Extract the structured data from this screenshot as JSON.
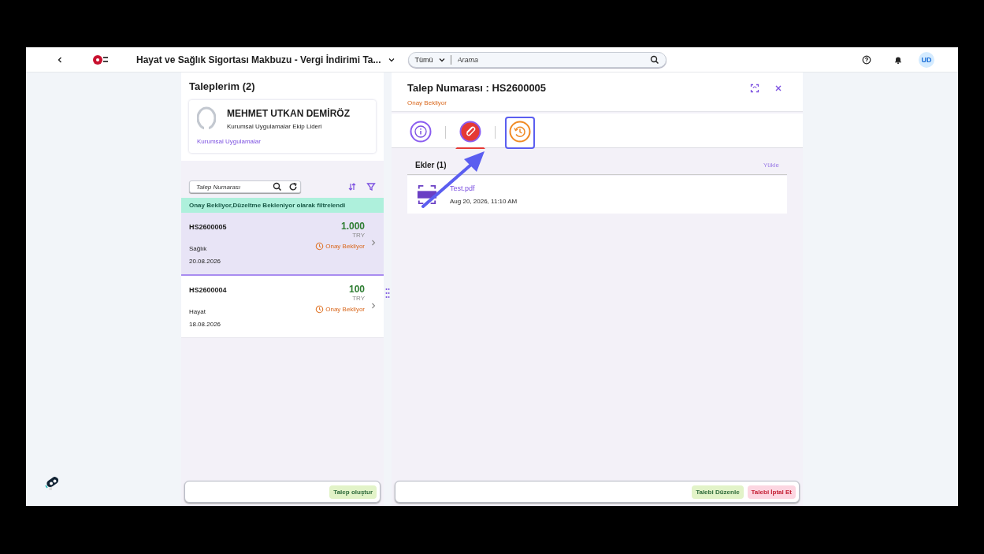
{
  "header": {
    "title": "Hayat ve Sağlık Sigortası Makbuzu - Vergi İndirimi Ta...",
    "search": {
      "scope": "Tümü",
      "placeholder": "Arama"
    },
    "avatar": "UD"
  },
  "list_panel": {
    "title": "Taleplerim (2)",
    "profile": {
      "name": "MEHMET UTKAN DEMİRÖZ",
      "role": "Kurumsal Uygulamalar Ekip Lideri",
      "department": "Kurumsal Uygulamalar"
    },
    "search": {
      "placeholder": "Talep Numarası"
    },
    "filter_banner": "Onay Bekliyor,Düzeltme Bekleniyor olarak filtrelendi",
    "items": [
      {
        "number": "HS2600005",
        "amount": "1.000",
        "currency": "TRY",
        "type": "Sağlık",
        "status": "Onay Bekliyor",
        "date": "20.08.2026",
        "selected": true
      },
      {
        "number": "HS2600004",
        "amount": "100",
        "currency": "TRY",
        "type": "Hayat",
        "status": "Onay Bekliyor",
        "date": "18.08.2026",
        "selected": false
      }
    ],
    "footer_buttons": [
      {
        "label": "Talep oluştur",
        "kind": "positive"
      }
    ]
  },
  "detail_panel": {
    "title": "Talep Numarası : HS2600005",
    "status": "Onay Bekliyor",
    "tabs": [
      {
        "kind": "info",
        "selected": false,
        "highlighted": false
      },
      {
        "kind": "attachments",
        "selected": true,
        "highlighted": false
      },
      {
        "kind": "history",
        "selected": false,
        "highlighted": true
      }
    ],
    "attachments": {
      "title": "Ekler (1)",
      "upload": "Yükle",
      "files": [
        {
          "name": "Test.pdf",
          "date": "Aug 20, 2026, 11:10 AM"
        }
      ]
    },
    "footer_buttons": [
      {
        "label": "Talebi Düzenle",
        "kind": "positive"
      },
      {
        "label": "Talebi İptal Et",
        "kind": "negative"
      }
    ]
  }
}
